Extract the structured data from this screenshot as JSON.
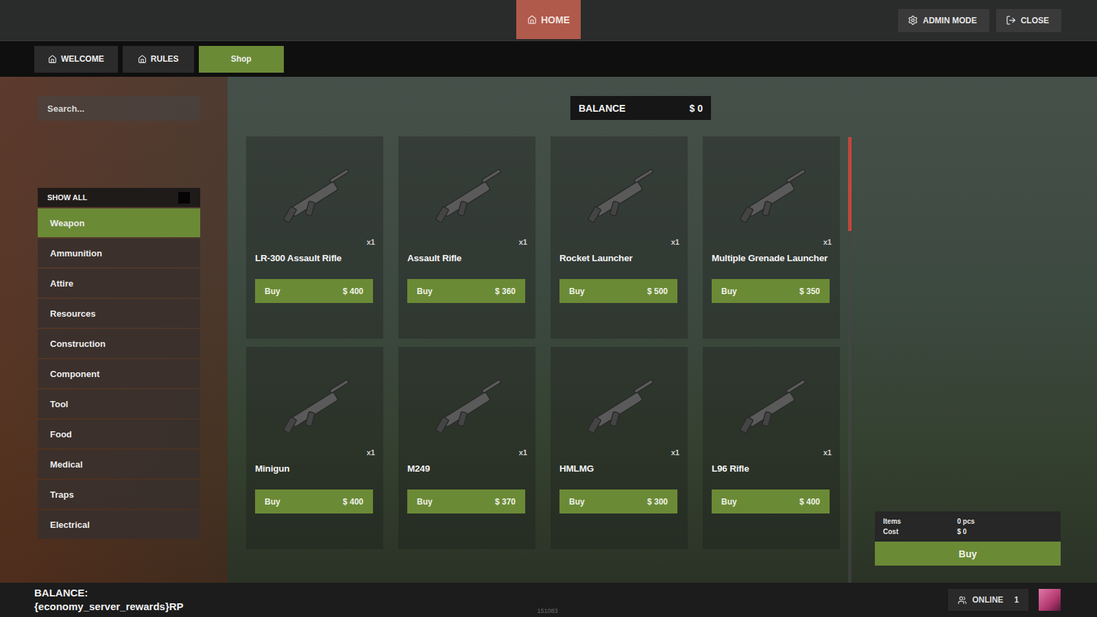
{
  "topbar": {
    "home": "HOME",
    "admin": "ADMIN MODE",
    "close": "CLOSE"
  },
  "tabs": [
    {
      "label": "WELCOME",
      "selected": false,
      "icon": true
    },
    {
      "label": "RULES",
      "selected": false,
      "icon": true
    },
    {
      "label": "Shop",
      "selected": true,
      "icon": false
    }
  ],
  "search": {
    "placeholder": "Search..."
  },
  "balance": {
    "label": "BALANCE",
    "value": "$ 0"
  },
  "categories": {
    "show_all": {
      "label": "SHOW ALL",
      "checked": false
    },
    "items": [
      {
        "label": "Weapon",
        "selected": true
      },
      {
        "label": "Ammunition",
        "selected": false
      },
      {
        "label": "Attire",
        "selected": false
      },
      {
        "label": "Resources",
        "selected": false
      },
      {
        "label": "Construction",
        "selected": false
      },
      {
        "label": "Component",
        "selected": false
      },
      {
        "label": "Tool",
        "selected": false
      },
      {
        "label": "Food",
        "selected": false
      },
      {
        "label": "Medical",
        "selected": false
      },
      {
        "label": "Traps",
        "selected": false
      },
      {
        "label": "Electrical",
        "selected": false
      }
    ]
  },
  "products": [
    {
      "name": "LR-300 Assault Rifle",
      "qty": "x1",
      "button": "Buy",
      "price": "$ 400"
    },
    {
      "name": "Assault Rifle",
      "qty": "x1",
      "button": "Buy",
      "price": "$ 360"
    },
    {
      "name": "Rocket Launcher",
      "qty": "x1",
      "button": "Buy",
      "price": "$ 500"
    },
    {
      "name": "Multiple Grenade Launcher",
      "qty": "x1",
      "button": "Buy",
      "price": "$ 350"
    },
    {
      "name": "Minigun",
      "qty": "x1",
      "button": "Buy",
      "price": "$ 400"
    },
    {
      "name": "M249",
      "qty": "x1",
      "button": "Buy",
      "price": "$ 370"
    },
    {
      "name": "HMLMG",
      "qty": "x1",
      "button": "Buy",
      "price": "$ 300"
    },
    {
      "name": "L96 Rifle",
      "qty": "x1",
      "button": "Buy",
      "price": "$ 400"
    }
  ],
  "scrollbar": {
    "level": 0.21
  },
  "cart": {
    "items_label": "Items",
    "items_value": "0 pcs",
    "cost_label": "Cost",
    "cost_value": "$ 0",
    "button": "Buy"
  },
  "footer": {
    "balance_label": "BALANCE:",
    "balance_value": "{economy_server_rewards}RP",
    "build": "151083",
    "online_label": "ONLINE",
    "online_count": "1"
  }
}
